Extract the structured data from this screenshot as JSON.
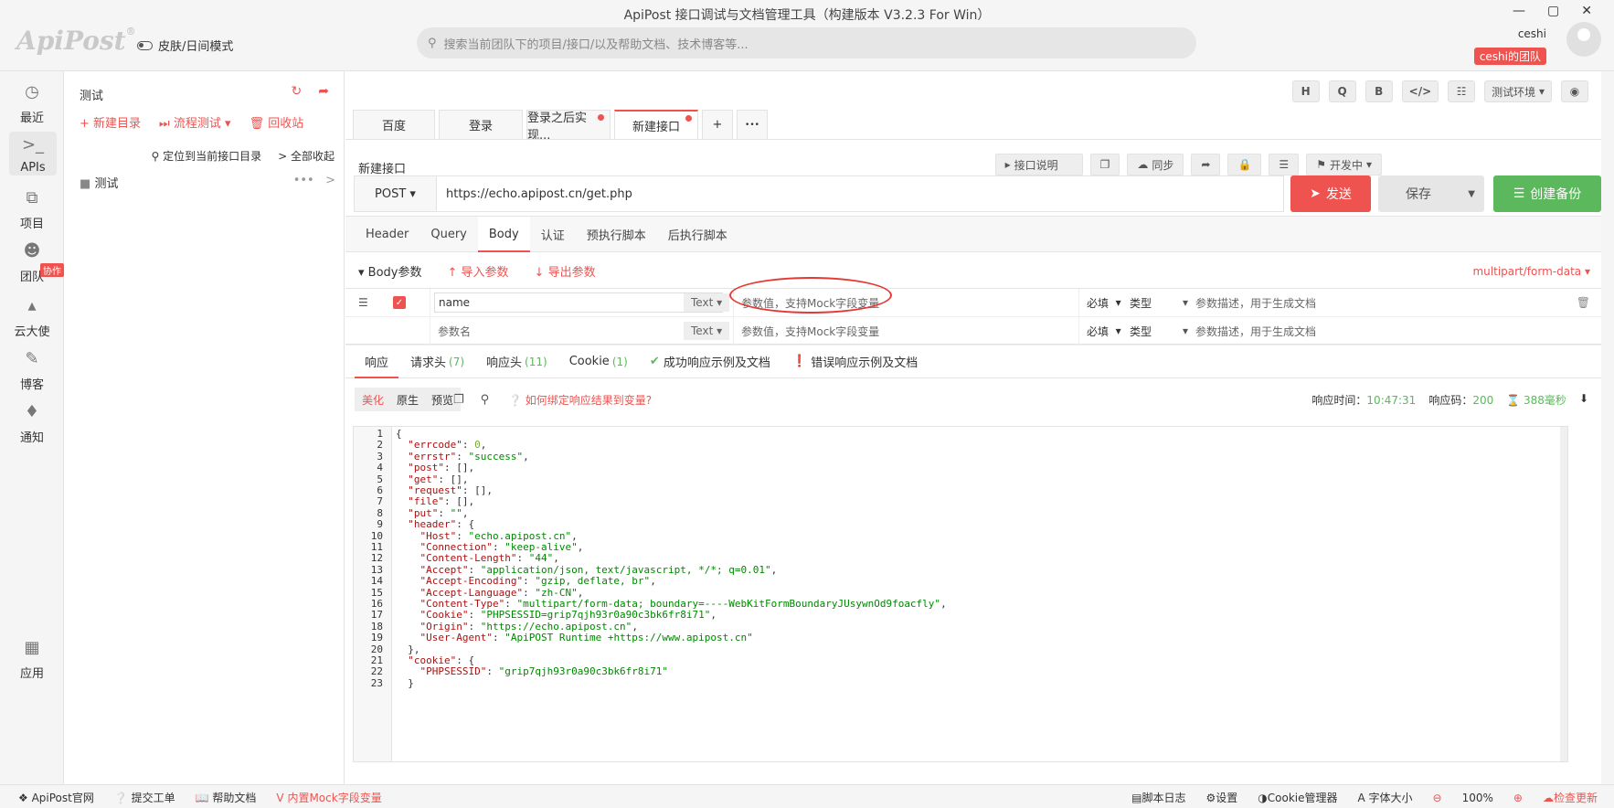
{
  "window": {
    "title": "ApiPost 接口调试与文档管理工具（构建版本 V3.2.3 For Win）"
  },
  "header": {
    "logo": "ApiPost",
    "logo_mark": "®",
    "skin_toggle": "皮肤/日间模式",
    "search_placeholder": "搜索当前团队下的项目/接口/以及帮助文档、技术博客等...",
    "username": "ceshi",
    "team_badge": "ceshi的团队"
  },
  "leftnav": {
    "items": [
      {
        "icon": "clock-icon",
        "label": "最近"
      },
      {
        "icon": "terminal-icon",
        "label": "APIs"
      },
      {
        "icon": "project-icon",
        "label": "项目"
      },
      {
        "icon": "team-icon",
        "label": "团队"
      },
      {
        "icon": "graduation-icon",
        "label": "云大使"
      },
      {
        "icon": "edit-icon",
        "label": "博客"
      },
      {
        "icon": "bell-icon",
        "label": "通知"
      },
      {
        "icon": "apps-icon",
        "label": "应用"
      }
    ],
    "team_badge": "协作"
  },
  "tree": {
    "project_name": "测试",
    "new_dir": "新建目录",
    "flow_test": "流程测试",
    "recycle": "回收站",
    "locate": "定位到当前接口目录",
    "collapse": "全部收起",
    "folder": "测试"
  },
  "toolbar": {
    "h": "H",
    "q": "Q",
    "b": "B",
    "code": "</>",
    "sliders": "☷",
    "env": "测试环境",
    "eye": "◉"
  },
  "tabs": [
    {
      "label": "百度",
      "dot": false
    },
    {
      "label": "登录",
      "dot": false
    },
    {
      "label": "登录之后实现...",
      "dot": true
    },
    {
      "label": "新建接口",
      "dot": true
    },
    {
      "label": "+",
      "dot": false
    },
    {
      "label": "•••",
      "dot": false
    }
  ],
  "api": {
    "name": "新建接口",
    "doc_btn": "接口说明",
    "sync_btn": "同步",
    "status": "开发中",
    "method": "POST",
    "url": "https://echo.apipost.cn/get.php",
    "send": "发送",
    "save": "保存",
    "backup": "创建备份"
  },
  "request_tabs": [
    "Header",
    "Query",
    "Body",
    "认证",
    "预执行脚本",
    "后执行脚本"
  ],
  "body": {
    "title": "Body参数",
    "import": "导入参数",
    "export": "导出参数",
    "content_type": "multipart/form-data"
  },
  "params": [
    {
      "name": "name",
      "type": "Text",
      "value_placeholder": "参数值，支持Mock字段变量",
      "required": "必填",
      "kind": "类型",
      "desc_placeholder": "参数描述，用于生成文档"
    },
    {
      "name": "参数名",
      "type": "Text",
      "value_placeholder": "参数值，支持Mock字段变量",
      "required": "必填",
      "kind": "类型",
      "desc_placeholder": "参数描述，用于生成文档"
    }
  ],
  "response_tabs": {
    "resp": "响应",
    "req_headers": "请求头",
    "req_count": "(7)",
    "resp_headers": "响应头",
    "resp_count": "(11)",
    "cookie": "Cookie",
    "cookie_count": "(1)",
    "success_doc": "成功响应示例及文档",
    "error_doc": "错误响应示例及文档"
  },
  "view": {
    "pretty": "美化",
    "raw": "原生",
    "preview": "预览",
    "howto": "如何绑定响应结果到变量?"
  },
  "resp_info": {
    "time_label": "响应时间：",
    "time": "10:47:31",
    "code_label": "响应码：",
    "code": "200",
    "duration": "388毫秒"
  },
  "code_lines": [
    [
      "{",
      ""
    ],
    [
      "  \"errcode\": 0,",
      ""
    ],
    [
      "  \"errstr\": \"success\",",
      ""
    ],
    [
      "  \"post\": [],",
      ""
    ],
    [
      "  \"get\": [],",
      ""
    ],
    [
      "  \"request\": [],",
      ""
    ],
    [
      "  \"file\": [],",
      ""
    ],
    [
      "  \"put\": \"\",",
      ""
    ],
    [
      "  \"header\": {",
      ""
    ],
    [
      "    \"Host\": \"echo.apipost.cn\",",
      ""
    ],
    [
      "    \"Connection\": \"keep-alive\",",
      ""
    ],
    [
      "    \"Content-Length\": \"44\",",
      ""
    ],
    [
      "    \"Accept\": \"application/json, text/javascript, */*; q=0.01\",",
      ""
    ],
    [
      "    \"Accept-Encoding\": \"gzip, deflate, br\",",
      ""
    ],
    [
      "    \"Accept-Language\": \"zh-CN\",",
      ""
    ],
    [
      "    \"Content-Type\": \"multipart/form-data; boundary=----WebKitFormBoundaryJUsywnOd9foacfly\",",
      ""
    ],
    [
      "    \"Cookie\": \"PHPSESSID=grip7qjh93r0a90c3bk6fr8i71\",",
      ""
    ],
    [
      "    \"Origin\": \"https://echo.apipost.cn\",",
      ""
    ],
    [
      "    \"User-Agent\": \"ApiPOST Runtime +https://www.apipost.cn\"",
      ""
    ],
    [
      "  },",
      ""
    ],
    [
      "  \"cookie\": {",
      ""
    ],
    [
      "    \"PHPSESSID\": \"grip7qjh93r0a90c3bk6fr8i71\"",
      ""
    ],
    [
      "  }",
      ""
    ]
  ],
  "statusbar": {
    "official": "ApiPost官网",
    "ticket": "提交工单",
    "help": "帮助文档",
    "mock": "内置Mock字段变量",
    "script_log": "脚本日志",
    "settings": "设置",
    "cookie_mgr": "Cookie管理器",
    "font": "字体大小",
    "zoom": "100%",
    "update": "检查更新"
  }
}
